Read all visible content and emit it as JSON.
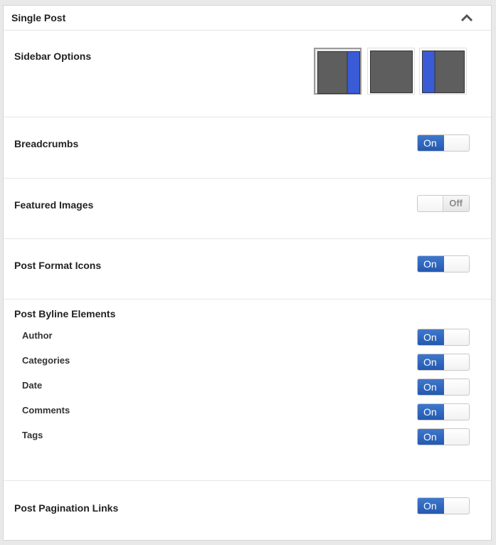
{
  "panel": {
    "title": "Single Post"
  },
  "sidebar_options": {
    "label": "Sidebar Options",
    "options": [
      "right-sidebar",
      "no-sidebar",
      "left-sidebar"
    ],
    "selected": "right-sidebar"
  },
  "breadcrumbs": {
    "label": "Breadcrumbs",
    "state": "On"
  },
  "featured_images": {
    "label": "Featured Images",
    "state": "Off"
  },
  "post_format_icons": {
    "label": "Post Format Icons",
    "state": "On"
  },
  "post_byline": {
    "label": "Post Byline Elements",
    "items": [
      {
        "label": "Author",
        "state": "On"
      },
      {
        "label": "Categories",
        "state": "On"
      },
      {
        "label": "Date",
        "state": "On"
      },
      {
        "label": "Comments",
        "state": "On"
      },
      {
        "label": "Tags",
        "state": "On"
      }
    ]
  },
  "post_pagination": {
    "label": "Post Pagination Links",
    "state": "On"
  },
  "colors": {
    "accent": "#2c62bd",
    "sidebar_blue": "#3a5bd6",
    "layout_gray": "#5e5e5e"
  }
}
